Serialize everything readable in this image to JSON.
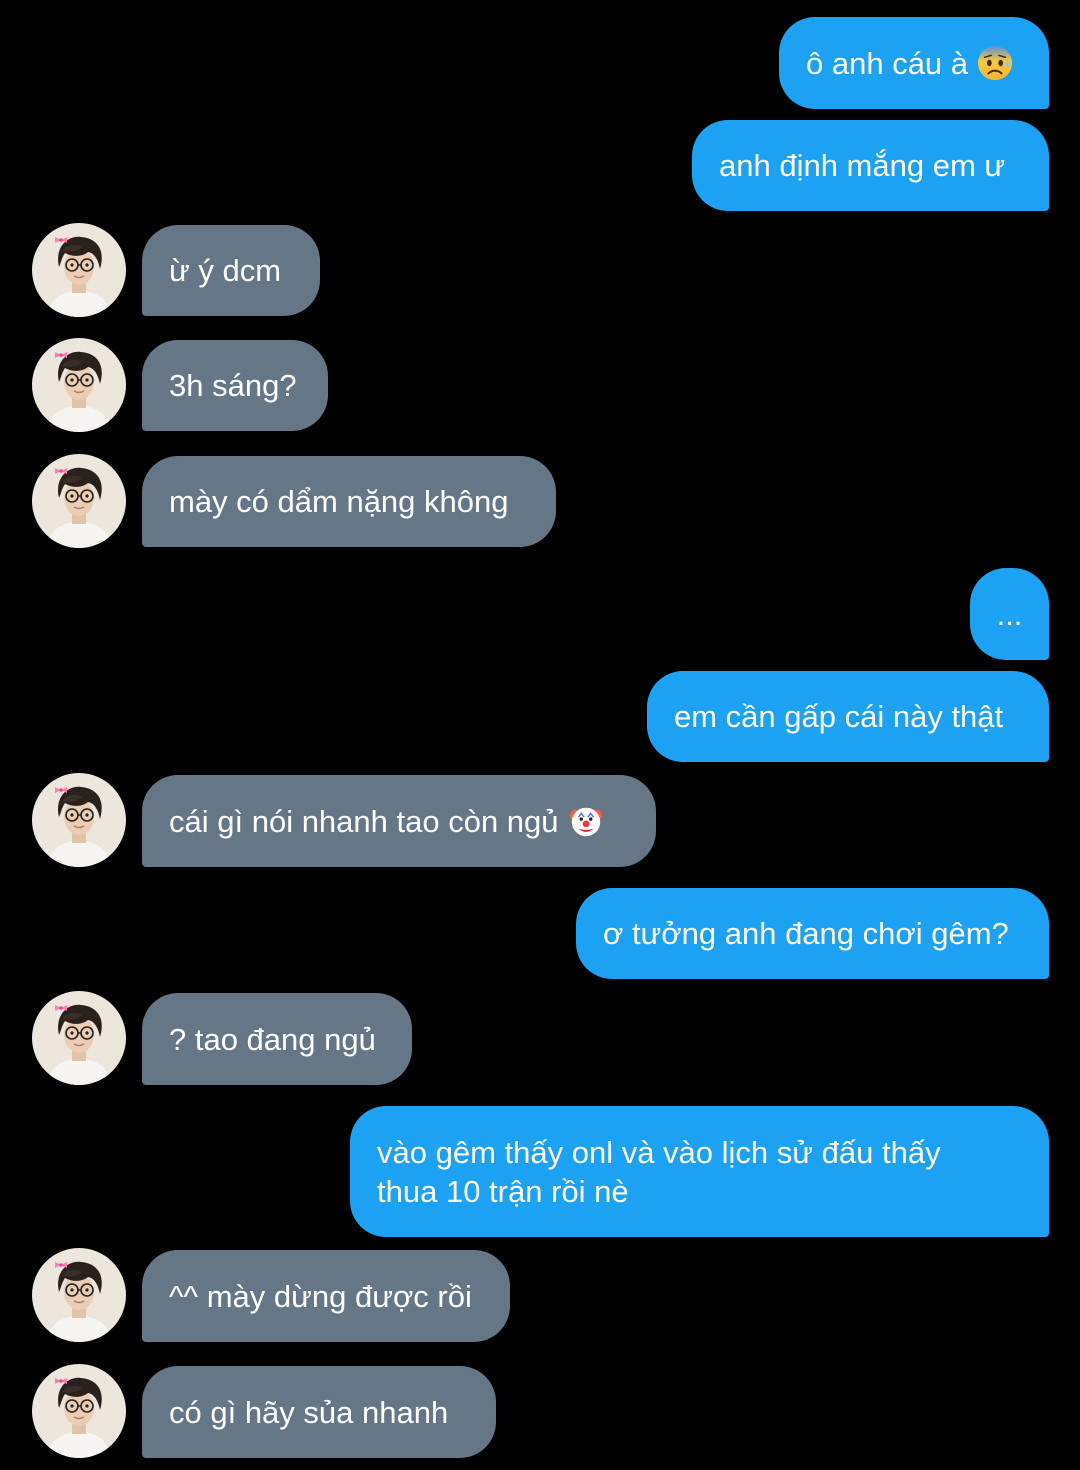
{
  "colors": {
    "background": "#000000",
    "outgoing_bubble": "#1da1f2",
    "incoming_bubble": "#657786",
    "text": "#ffffff"
  },
  "messages": [
    {
      "side": "out",
      "text": "ô anh cáu à",
      "emoji": "anxious-face-with-sweat-icon"
    },
    {
      "side": "out",
      "text": "anh định mắng em ư"
    },
    {
      "side": "in",
      "text": "ừ ý dcm"
    },
    {
      "side": "in",
      "text": "3h sáng?"
    },
    {
      "side": "in",
      "text": "mày có dẩm nặng không"
    },
    {
      "side": "out",
      "text": "..."
    },
    {
      "side": "out",
      "text": "em cần gấp cái này thật"
    },
    {
      "side": "in",
      "text": "cái gì nói nhanh tao còn ngủ",
      "emoji": "clown-face-icon"
    },
    {
      "side": "out",
      "text": "ơ tưởng anh đang chơi gêm?"
    },
    {
      "side": "in",
      "text": "? tao đang ngủ"
    },
    {
      "side": "out",
      "text": "vào gêm thấy onl và vào lịch sử đấu thấy thua 10 trận rồi nè"
    },
    {
      "side": "in",
      "text": "^^ mày dừng được rồi"
    },
    {
      "side": "in",
      "text": "có gì hãy sủa nhanh"
    }
  ]
}
